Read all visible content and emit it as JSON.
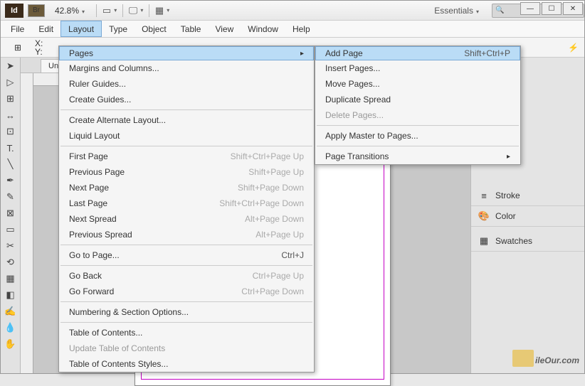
{
  "title": {
    "app": "Id",
    "bridge": "Br",
    "zoom": "42.8%",
    "workspace": "Essentials",
    "search_placeholder": ""
  },
  "menubar": [
    "File",
    "Edit",
    "Layout",
    "Type",
    "Object",
    "Table",
    "View",
    "Window",
    "Help"
  ],
  "coords": {
    "x": "X:",
    "y": "Y:"
  },
  "tab": "Untit",
  "layout_menu": {
    "pages": "Pages",
    "margins": "Margins and Columns...",
    "ruler_guides": "Ruler Guides...",
    "create_guides": "Create Guides...",
    "alt_layout": "Create Alternate Layout...",
    "liquid": "Liquid Layout",
    "first_page": {
      "l": "First Page",
      "s": "Shift+Ctrl+Page Up"
    },
    "prev_page": {
      "l": "Previous Page",
      "s": "Shift+Page Up"
    },
    "next_page": {
      "l": "Next Page",
      "s": "Shift+Page Down"
    },
    "last_page": {
      "l": "Last Page",
      "s": "Shift+Ctrl+Page Down"
    },
    "next_spread": {
      "l": "Next Spread",
      "s": "Alt+Page Down"
    },
    "prev_spread": {
      "l": "Previous Spread",
      "s": "Alt+Page Up"
    },
    "goto": {
      "l": "Go to Page...",
      "s": "Ctrl+J"
    },
    "go_back": {
      "l": "Go Back",
      "s": "Ctrl+Page Up"
    },
    "go_fwd": {
      "l": "Go Forward",
      "s": "Ctrl+Page Down"
    },
    "numbering": "Numbering & Section Options...",
    "toc": "Table of Contents...",
    "update_toc": "Update Table of Contents",
    "toc_styles": "Table of Contents Styles..."
  },
  "pages_menu": {
    "add": {
      "l": "Add Page",
      "s": "Shift+Ctrl+P"
    },
    "insert": "Insert Pages...",
    "move": "Move Pages...",
    "dup": "Duplicate Spread",
    "del": "Delete Pages...",
    "apply_master": "Apply Master to Pages...",
    "transitions": "Page Transitions"
  },
  "panels": {
    "stroke": "Stroke",
    "color": "Color",
    "swatches": "Swatches"
  },
  "watermark": "ileOur.com"
}
